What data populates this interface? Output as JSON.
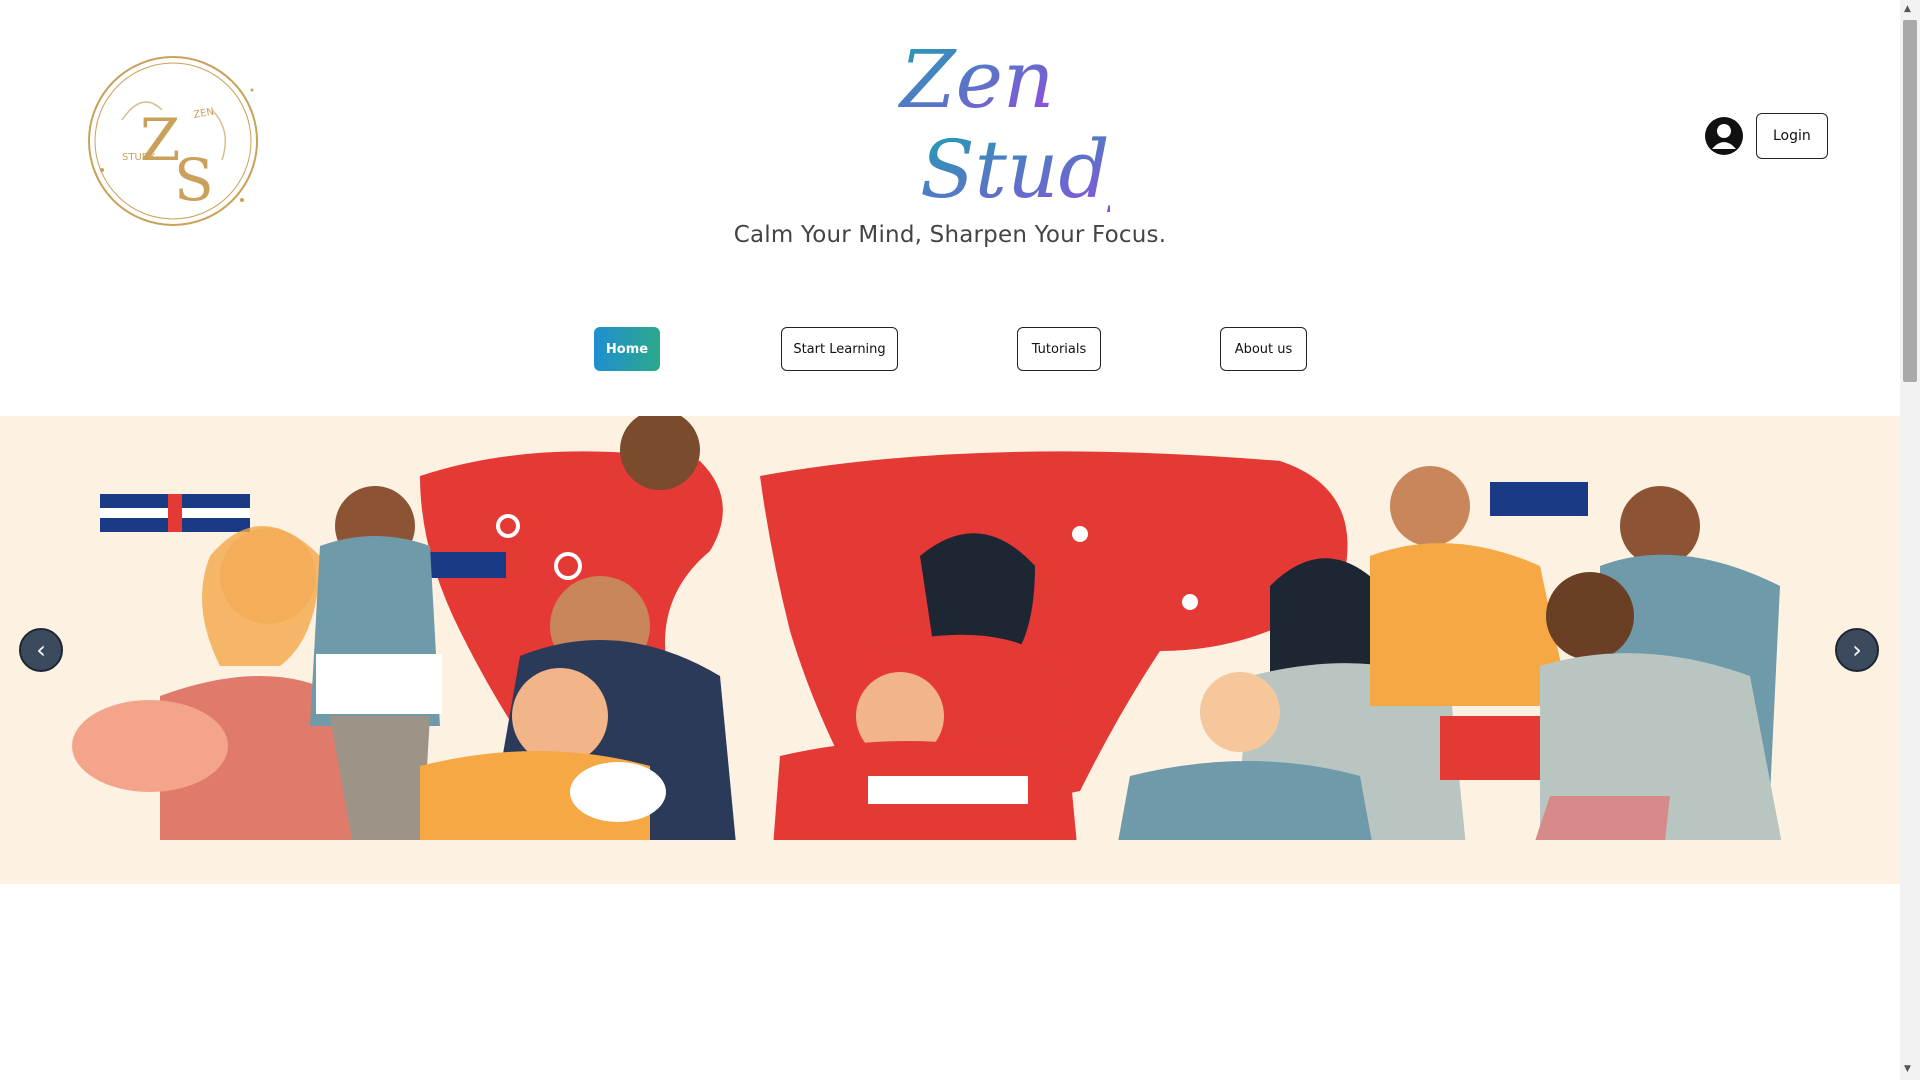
{
  "header": {
    "tagline": "Calm Your Mind, Sharpen Your Focus.",
    "logo_monogram": "ZS",
    "logo_text": "ZEN STUDY",
    "brand_script": [
      "Zen",
      "Study"
    ]
  },
  "user": {
    "avatar_icon": "user-circle-icon",
    "login_label": "Login"
  },
  "nav": {
    "items": [
      {
        "label": "Home",
        "active": true
      },
      {
        "label": "Start Learning",
        "active": false
      },
      {
        "label": "Tutorials",
        "active": false
      },
      {
        "label": "About us",
        "active": false
      }
    ]
  },
  "carousel": {
    "prev_label": "‹",
    "next_label": "›",
    "image_description_icon": "world-map-people-illustration"
  },
  "colors": {
    "accent_gradient_start": "#1f8fd0",
    "accent_gradient_end": "#2aa98a",
    "logo_gold": "#c9a15a",
    "script_teal": "#1aa3b0",
    "script_purple": "#9b45e0",
    "banner_bg": "#fdf1e2",
    "map_red": "#e53935"
  }
}
